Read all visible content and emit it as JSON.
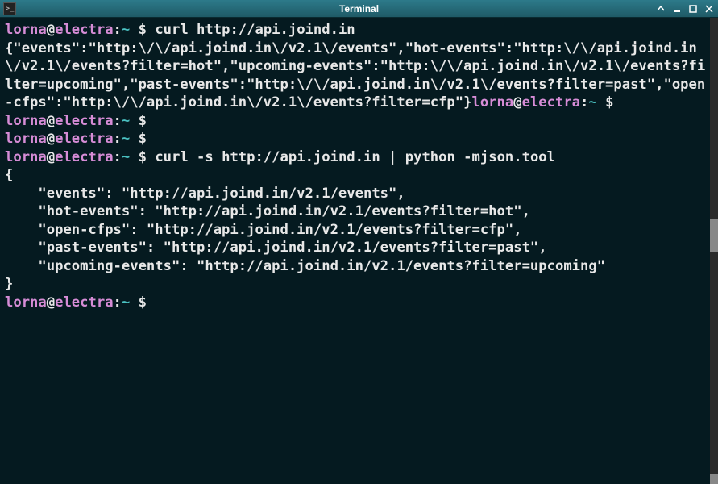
{
  "window": {
    "title": "Terminal",
    "icons": {
      "app": "terminal-icon",
      "roll_up": "rollup-icon",
      "minimize": "minimize-icon",
      "maximize": "maximize-icon",
      "close": "close-icon"
    }
  },
  "colors": {
    "background": "#051a20",
    "titlebar": "#1f5a66",
    "user": "#d68cd6",
    "path": "#4ac0c0",
    "text": "#e8e8e8"
  },
  "prompt": {
    "user": "lorna",
    "host": "electra",
    "path": "~",
    "symbol": "$"
  },
  "lines": [
    {
      "type": "prompt",
      "cmd": "curl http://api.joind.in"
    },
    {
      "type": "output-with-inline-prompt",
      "text": "{\"events\":\"http:\\/\\/api.joind.in\\/v2.1\\/events\",\"hot-events\":\"http:\\/\\/api.joind.in\\/v2.1\\/events?filter=hot\",\"upcoming-events\":\"http:\\/\\/api.joind.in\\/v2.1\\/events?filter=upcoming\",\"past-events\":\"http:\\/\\/api.joind.in\\/v2.1\\/events?filter=past\",\"open-cfps\":\"http:\\/\\/api.joind.in\\/v2.1\\/events?filter=cfp\"}",
      "cmd": ""
    },
    {
      "type": "prompt",
      "cmd": ""
    },
    {
      "type": "prompt",
      "cmd": ""
    },
    {
      "type": "prompt",
      "cmd": "curl -s http://api.joind.in | python -mjson.tool"
    },
    {
      "type": "output",
      "text": "{"
    },
    {
      "type": "output",
      "text": "    \"events\": \"http://api.joind.in/v2.1/events\","
    },
    {
      "type": "output",
      "text": "    \"hot-events\": \"http://api.joind.in/v2.1/events?filter=hot\","
    },
    {
      "type": "output",
      "text": "    \"open-cfps\": \"http://api.joind.in/v2.1/events?filter=cfp\","
    },
    {
      "type": "output",
      "text": "    \"past-events\": \"http://api.joind.in/v2.1/events?filter=past\","
    },
    {
      "type": "output",
      "text": "    \"upcoming-events\": \"http://api.joind.in/v2.1/events?filter=upcoming\""
    },
    {
      "type": "output",
      "text": "}"
    },
    {
      "type": "prompt",
      "cmd": ""
    }
  ]
}
